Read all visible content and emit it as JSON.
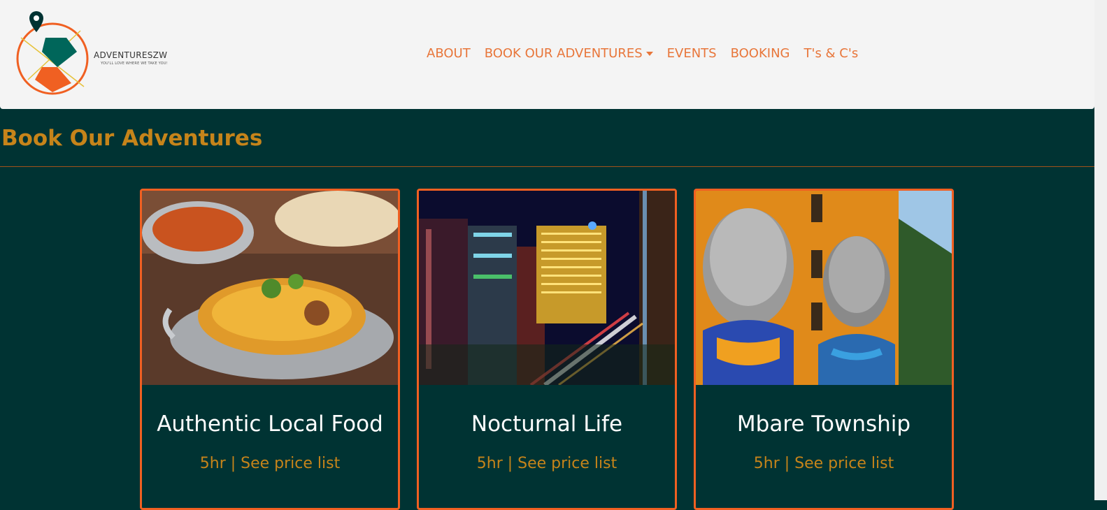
{
  "brand": {
    "name": "ADVENTURESZW",
    "tagline": "YOU'LL LOVE WHERE WE TAKE YOU!",
    "colors": {
      "orange": "#f06022",
      "teal": "#00665a",
      "gold": "#c6841a",
      "dark": "#003333"
    }
  },
  "nav": {
    "about": "ABOUT",
    "book": "BOOK OUR ADVENTURES",
    "events": "EVENTS",
    "booking": "BOOKING",
    "terms": "T's & C's"
  },
  "page": {
    "title": "Book Our Adventures"
  },
  "cards": [
    {
      "title": "Authentic Local Food",
      "meta": "5hr | See price list",
      "image": "food-bowl-image"
    },
    {
      "title": "Nocturnal Life",
      "meta": "5hr | See price list",
      "image": "city-night-image"
    },
    {
      "title": "Mbare Township",
      "meta": "5hr | See price list",
      "image": "mural-image"
    }
  ]
}
